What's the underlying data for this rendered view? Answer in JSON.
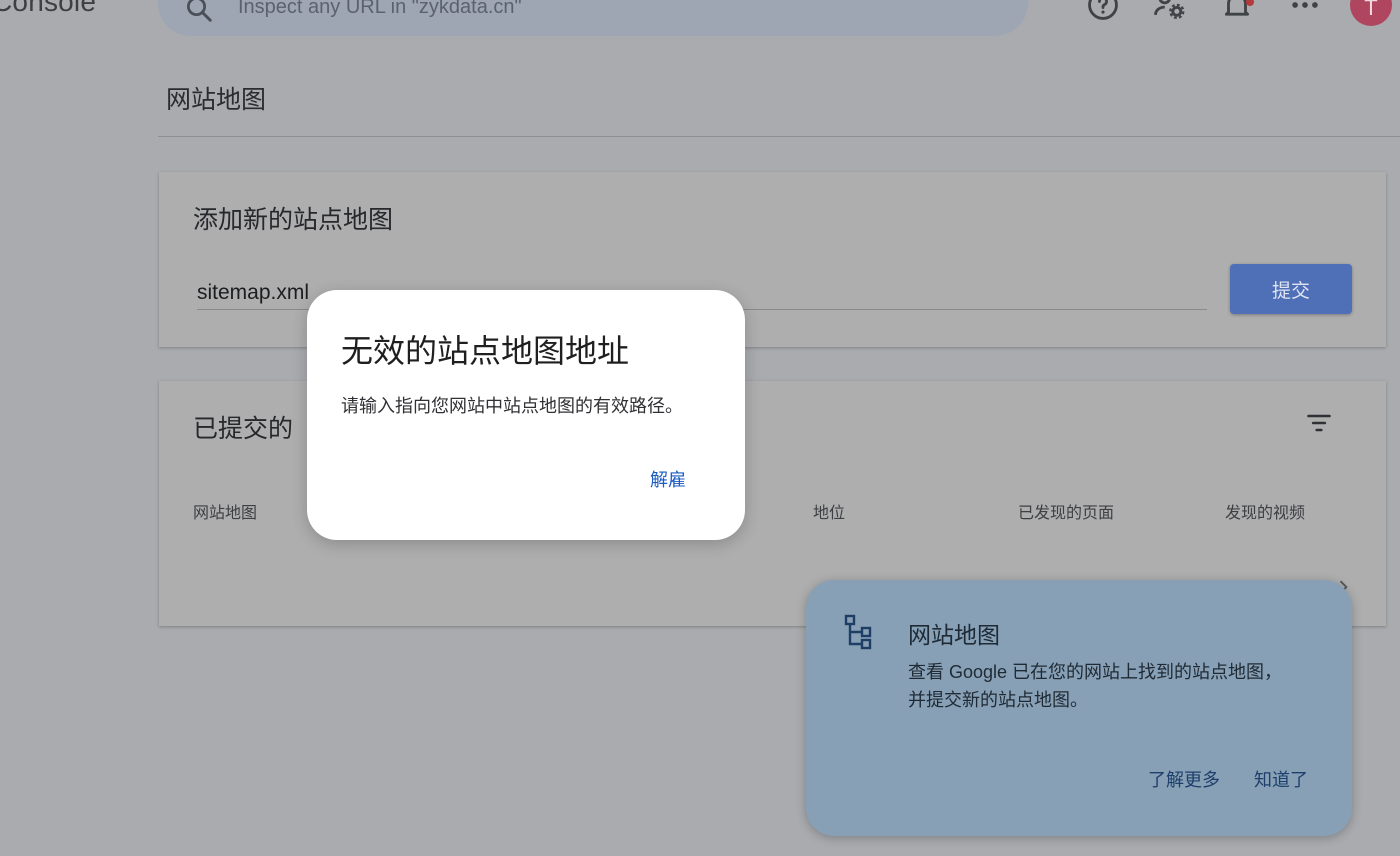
{
  "app": {
    "brand": "Console"
  },
  "search": {
    "text": "Inspect any URL in \"zykdata.cn\""
  },
  "avatar": {
    "initial": "T"
  },
  "page": {
    "title": "网站地图"
  },
  "add_card": {
    "title": "添加新的站点地图",
    "input_value": "sitemap.xml",
    "submit_label": "提交"
  },
  "submitted_card": {
    "title": "已提交的",
    "columns": [
      {
        "label": "网站地图"
      },
      {
        "label": "地位"
      },
      {
        "label": "已发现的页面"
      },
      {
        "label": "发现的视频"
      }
    ]
  },
  "dialog": {
    "title": "无效的站点地图地址",
    "body": "请输入指向您网站中站点地图的有效路径。",
    "dismiss_label": "解雇"
  },
  "tip": {
    "title": "网站地图",
    "body": "查看 Google 已在您的网站上找到的站点地图，并提交新的站点地图。",
    "learn_more_label": "了解更多",
    "got_it_label": "知道了"
  },
  "colors": {
    "scrim_background": "#a9abaf",
    "primary_button": "#4f6fb7",
    "dialog_action": "#1a5bc4",
    "tip_background": "#87a0b5",
    "avatar": "#b0455f"
  },
  "icons": [
    "search-icon",
    "help-icon",
    "admin-settings-icon",
    "notifications-icon",
    "apps-icon",
    "filter-icon",
    "chevron-right-icon",
    "sitemap-icon"
  ]
}
